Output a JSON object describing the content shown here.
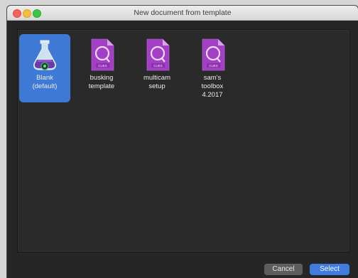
{
  "window": {
    "title": "New document from template"
  },
  "templates": [
    {
      "label": "Blank\n(default)",
      "icon": "qlab-flask-icon",
      "selected": true
    },
    {
      "label": "busking\ntemplate",
      "icon": "cues-document-icon",
      "badge": "CUES"
    },
    {
      "label": "multicam\nsetup",
      "icon": "cues-document-icon",
      "badge": "CUES"
    },
    {
      "label": "sam's\ntoolbox\n4.2017",
      "icon": "cues-document-icon",
      "badge": "CUES"
    }
  ],
  "buttons": {
    "cancel": "Cancel",
    "select": "Select"
  },
  "colors": {
    "accent": "#3e79d5",
    "document_purple": "#a23fc4",
    "background": "#262626"
  }
}
